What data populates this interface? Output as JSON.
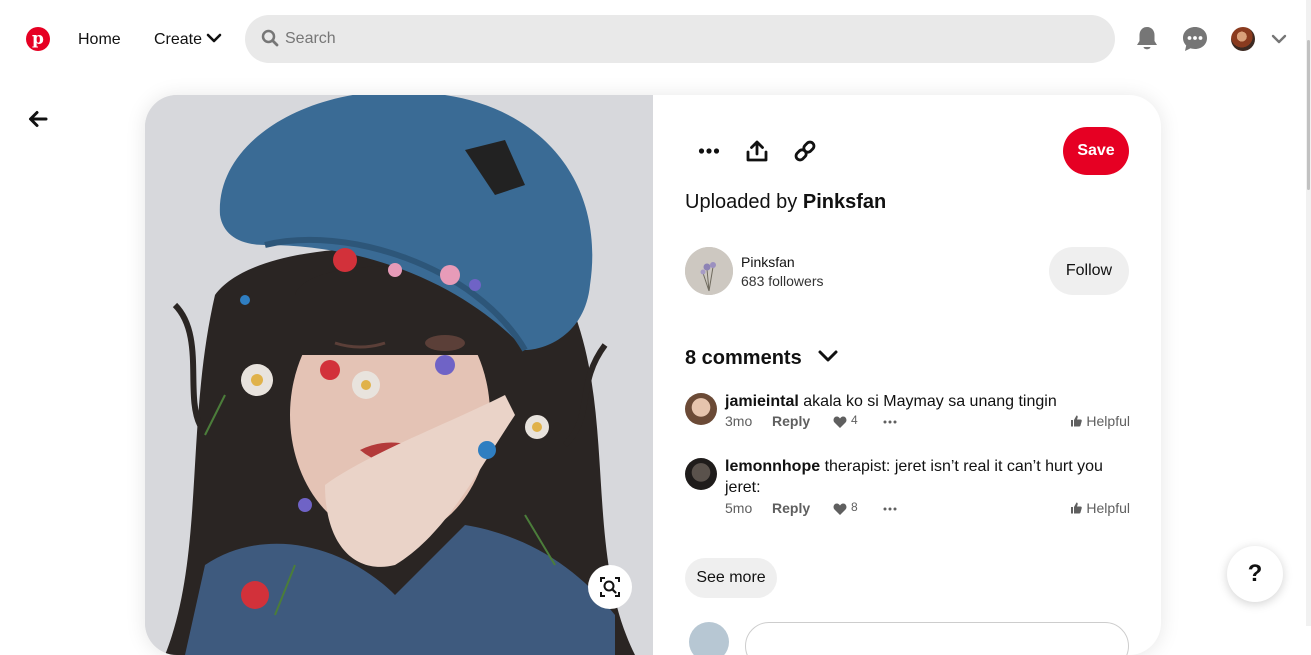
{
  "header": {
    "nav": {
      "home": "Home",
      "create": "Create"
    },
    "search": {
      "placeholder": "Search",
      "value": ""
    },
    "icons": [
      "pinterest-logo",
      "search-icon",
      "bell-icon",
      "message-icon",
      "avatar",
      "chevron-down-icon"
    ]
  },
  "colors": {
    "brand": "#e60023",
    "button_gray": "#efefef",
    "search_bg": "#e9e9e9"
  },
  "pin": {
    "actions": {
      "icons": [
        "more-icon",
        "share-icon",
        "link-icon"
      ],
      "save_label": "Save"
    },
    "uploaded_prefix": "Uploaded by",
    "uploader": "Pinksfan",
    "owner": {
      "name": "Pinksfan",
      "followers": "683 followers",
      "follow_label": "Follow"
    },
    "comments": {
      "title": "8 comments",
      "items": [
        {
          "user": "jamieintal",
          "text": "akala ko si Maymay sa unang tingin",
          "time": "3mo",
          "reply": "Reply",
          "likes": "4",
          "helpful": "Helpful"
        },
        {
          "user": "lemonnhope",
          "text": "therapist: jeret isn’t real it can’t hurt you jeret:",
          "time": "5mo",
          "reply": "Reply",
          "likes": "8",
          "helpful": "Helpful"
        }
      ],
      "see_more": "See more"
    }
  },
  "help": {
    "label": "?"
  }
}
